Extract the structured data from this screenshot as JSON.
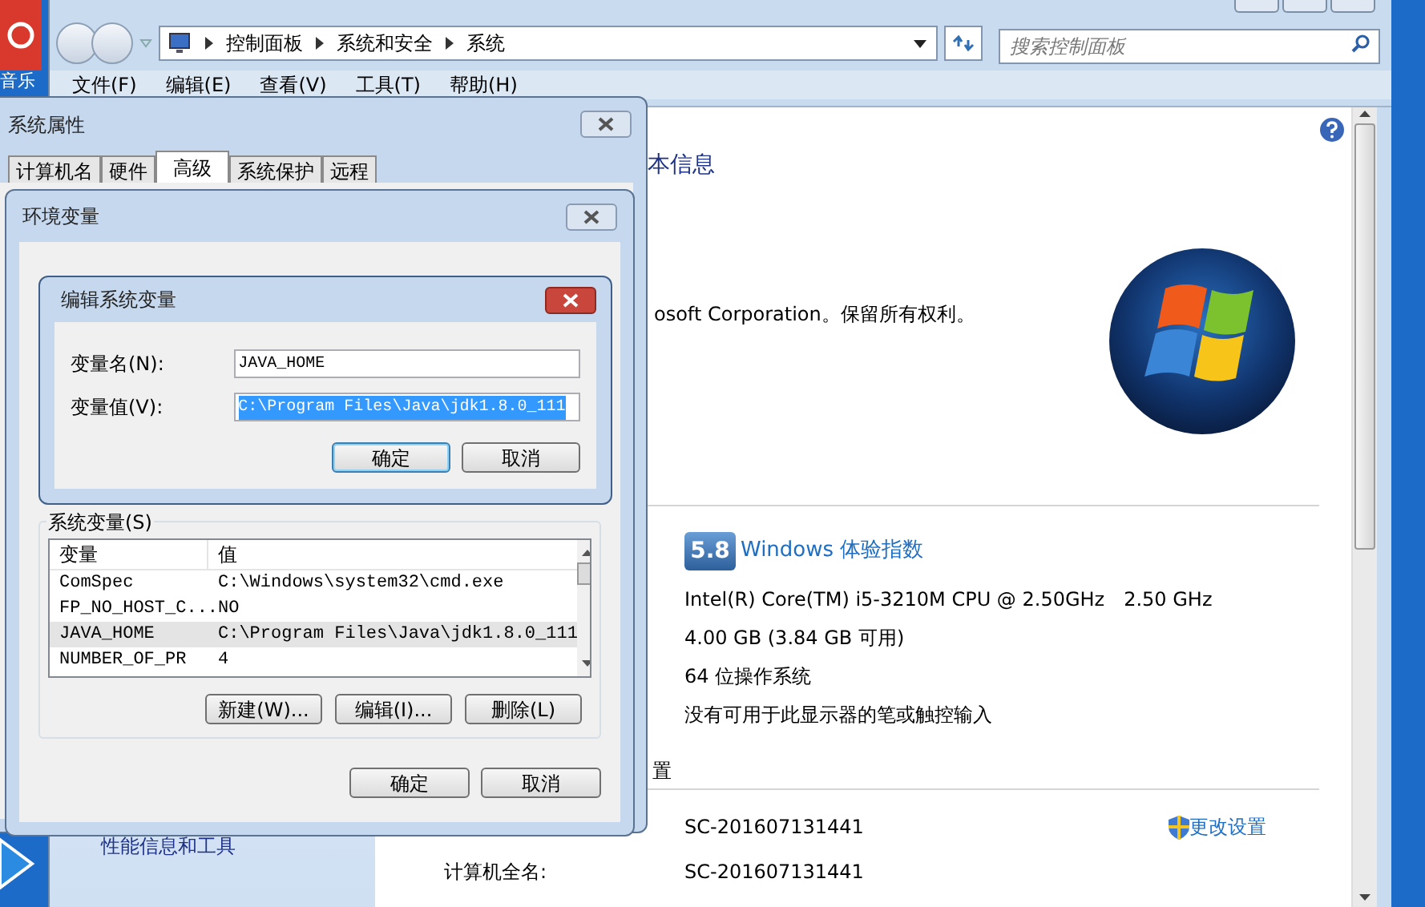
{
  "desktop": {
    "icon_label": "音乐"
  },
  "explorer": {
    "breadcrumb": [
      "控制面板",
      "系统和安全",
      "系统"
    ],
    "search": {
      "placeholder": "搜索控制面板"
    },
    "menu": [
      "文件(F)",
      "编辑(E)",
      "查看(V)",
      "工具(T)",
      "帮助(H)"
    ],
    "left_pane": {
      "links": [
        "性能信息和工具"
      ]
    },
    "content": {
      "heading": "本信息",
      "copyright": "osoft Corporation。保留所有权利。",
      "rating": {
        "score": "5.8",
        "link": "Windows 体验指数"
      },
      "processor": {
        "name": "Intel(R) Core(TM) i5-3210M CPU @ 2.50GHz",
        "speed": "2.50 GHz"
      },
      "system_lines": [
        "4.00 GB (3.84 GB 可用)",
        "64 位操作系统",
        "没有可用于此显示器的笔或触控输入"
      ],
      "section_heading": "置",
      "computer_name": {
        "value": "SC-201607131441",
        "change_link": "更改设置"
      },
      "full_name": {
        "label": "计算机全名:",
        "value": "SC-201607131441"
      }
    }
  },
  "system_properties": {
    "title": "系统属性",
    "tabs": [
      {
        "label": "计算机名",
        "selected": false
      },
      {
        "label": "硬件",
        "selected": false
      },
      {
        "label": "高级",
        "selected": true
      },
      {
        "label": "系统保护",
        "selected": false
      },
      {
        "label": "远程",
        "selected": false
      }
    ]
  },
  "environment_variables": {
    "title": "环境变量",
    "group_label": "系统变量(S)",
    "columns": [
      "变量",
      "值"
    ],
    "rows": [
      {
        "name": "ComSpec",
        "value": "C:\\Windows\\system32\\cmd.exe",
        "selected": false
      },
      {
        "name": "FP_NO_HOST_C...",
        "value": "NO",
        "selected": false
      },
      {
        "name": "JAVA_HOME",
        "value": "C:\\Program Files\\Java\\jdk1.8.0_111",
        "selected": true
      },
      {
        "name": "NUMBER_OF_PR",
        "value": "4",
        "selected": false
      }
    ],
    "list_buttons": [
      "新建(W)...",
      "编辑(I)...",
      "删除(L)"
    ],
    "buttons": [
      "确定",
      "取消"
    ]
  },
  "edit_dialog": {
    "title": "编辑系统变量",
    "fields": [
      {
        "label": "变量名(N):",
        "value": "JAVA_HOME",
        "text_selected": false
      },
      {
        "label": "变量值(V):",
        "value": "C:\\Program Files\\Java\\jdk1.8.0_111",
        "text_selected": true
      }
    ],
    "buttons": [
      {
        "label": "确定",
        "default": true
      },
      {
        "label": "取消",
        "default": false
      }
    ]
  }
}
